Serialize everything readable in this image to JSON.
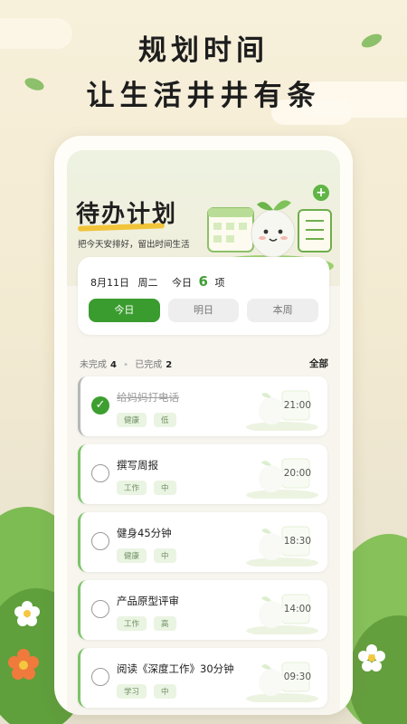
{
  "headline": {
    "line1": "规划时间",
    "line2": "让生活井井有条"
  },
  "hero": {
    "title": "待办计划",
    "subtitle": "把今天安排好，留出时间生活",
    "plus_icon": "+"
  },
  "summary": {
    "date": "8月11日",
    "weekday": "周二",
    "today_label": "今日",
    "count": "6",
    "unit": "项"
  },
  "tabs": [
    {
      "label": "今日"
    },
    {
      "label": "明日"
    },
    {
      "label": "本周"
    }
  ],
  "status": {
    "pending_label": "未完成",
    "pending_count": "4",
    "done_label": "已完成",
    "done_count": "2",
    "all_label": "全部"
  },
  "tasks": [
    {
      "title": "给妈妈打电话",
      "tags": [
        "健康",
        "低"
      ],
      "time": "21:00",
      "done": true
    },
    {
      "title": "撰写周报",
      "tags": [
        "工作",
        "中"
      ],
      "time": "20:00",
      "done": false
    },
    {
      "title": "健身45分钟",
      "tags": [
        "健康",
        "中"
      ],
      "time": "18:30",
      "done": false
    },
    {
      "title": "产品原型评审",
      "tags": [
        "工作",
        "高"
      ],
      "time": "14:00",
      "done": false
    },
    {
      "title": "阅读《深度工作》30分钟",
      "tags": [
        "学习",
        "中"
      ],
      "time": "09:30",
      "done": false
    }
  ],
  "colors": {
    "accent": "#3a9c2e",
    "highlight": "#f2c43a",
    "text": "#222222"
  }
}
